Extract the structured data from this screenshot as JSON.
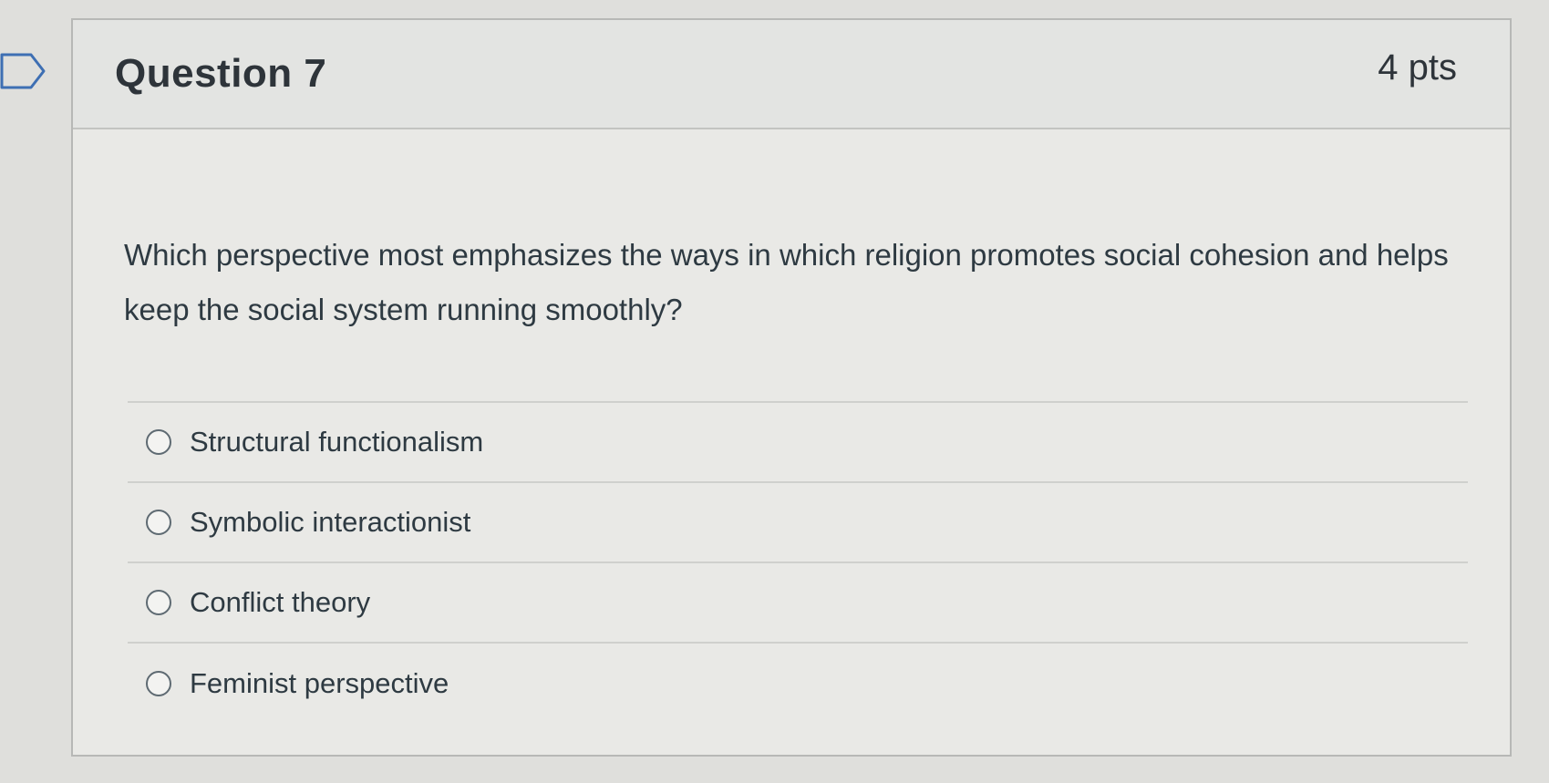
{
  "question": {
    "title": "Question 7",
    "points": "4 pts",
    "text": "Which perspective most emphasizes the ways in which religion promotes social cohesion and helps keep the social system running smoothly?",
    "answers": [
      {
        "label": "Structural functionalism",
        "icon": "radio-unselected-icon"
      },
      {
        "label": "Symbolic interactionist",
        "icon": "radio-unselected-icon"
      },
      {
        "label": "Conflict theory",
        "icon": "radio-unselected-icon"
      },
      {
        "label": "Feminist perspective",
        "icon": "radio-unselected-icon"
      }
    ]
  },
  "flag": {
    "icon": "flag-question-icon"
  },
  "colors": {
    "text": "#2e3a42",
    "card_background": "#e9e9e6",
    "header_background": "#e3e4e2",
    "border": "#b7b8b6"
  }
}
